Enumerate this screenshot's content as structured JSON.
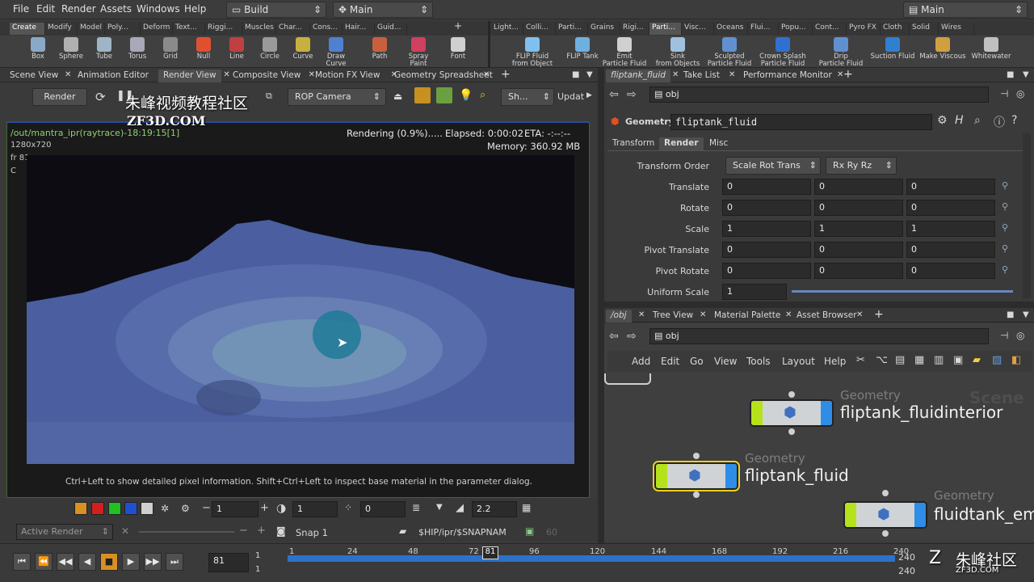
{
  "menubar": {
    "items": [
      "File",
      "Edit",
      "Render",
      "Assets",
      "Windows",
      "Help"
    ],
    "desktop": "Build",
    "context": "Main",
    "right": "Main"
  },
  "shelf_tabs_left": [
    "Create",
    "Modify",
    "Model",
    "Poly...",
    "Deform",
    "Text...",
    "Riggi...",
    "Muscles",
    "Char...",
    "Cons...",
    "Hair...",
    "Guid..."
  ],
  "shelf_tabs_right": [
    "Light...",
    "Colli...",
    "Parti...",
    "Grains",
    "Rigi...",
    "Parti...",
    "Visc...",
    "Oceans",
    "Flui...",
    "Popu...",
    "Cont...",
    "Pyro FX",
    "Cloth",
    "Solid",
    "Wires"
  ],
  "tools_left": [
    {
      "label": "Box",
      "color": "#8aa8c8"
    },
    {
      "label": "Sphere",
      "color": "#b0b0b0"
    },
    {
      "label": "Tube",
      "color": "#a0b4c8"
    },
    {
      "label": "Torus",
      "color": "#a8a8b8"
    },
    {
      "label": "Grid",
      "color": "#8a8a8a"
    },
    {
      "label": "Null",
      "color": "#e05030"
    },
    {
      "label": "Line",
      "color": "#c04040"
    },
    {
      "label": "Circle",
      "color": "#9a9a9a"
    },
    {
      "label": "Curve",
      "color": "#c8b040"
    },
    {
      "label": "Draw Curve",
      "color": "#5080d0"
    },
    {
      "label": "Path",
      "color": "#c86040"
    },
    {
      "label": "Spray Paint",
      "color": "#d04060"
    },
    {
      "label": "Font",
      "color": "#d0d0d0"
    }
  ],
  "tools_right": [
    {
      "label": "FLIP Fluid\nfrom Object",
      "color": "#80c0f0"
    },
    {
      "label": "FLIP Tank",
      "color": "#70b0e0"
    },
    {
      "label": "Emit\nParticle Fluid",
      "color": "#d0d0d0"
    },
    {
      "label": "Sink\nfrom Objects",
      "color": "#a0c0e0"
    },
    {
      "label": "Sculpted\nParticle Fluid",
      "color": "#6090d0"
    },
    {
      "label": "Crown Splash\nParticle Fluid",
      "color": "#3070d0"
    },
    {
      "label": "Drip\nParticle Fluid",
      "color": "#6090d0"
    },
    {
      "label": "Suction Fluid",
      "color": "#3080d0"
    },
    {
      "label": "Make Viscous",
      "color": "#d0a040"
    },
    {
      "label": "Whitewater",
      "color": "#c0c0c0"
    }
  ],
  "viewer_tabs": [
    "Scene View",
    "Animation Editor",
    "Render View",
    "Composite View",
    "Motion FX View",
    "Geometry Spreadsheet"
  ],
  "render_toolbar": {
    "render": "Render",
    "camera": "ROP Camera",
    "sh": "Sh...",
    "update": "Updat"
  },
  "render_info": {
    "path": "/out/mantra_ipr(raytrace)-18:19:15[1]",
    "res": "1280x720",
    "frame": "fr 81",
    "channel": "C",
    "status": "Rendering (0.9%).....",
    "elapsed": "Elapsed: 0:00:02",
    "eta": "ETA: -:--:--",
    "memory": "Memory:   360.92 MB",
    "hint": "Ctrl+Left to show detailed pixel information. Shift+Ctrl+Left to inspect base material in the parameter dialog."
  },
  "render_controls": {
    "frame_field": "1",
    "exposure": "1",
    "offset": "0",
    "gamma": "2.2",
    "active_render": "Active Render",
    "snap": "Snap 1",
    "snap_path": "$HIP/ipr/$SNAPNAM",
    "snap_num": "60"
  },
  "params_tabs": [
    "fliptank_fluid",
    "Take List",
    "Performance Monitor"
  ],
  "params": {
    "path": "obj",
    "type": "Geometry",
    "name": "fliptank_fluid",
    "subtabs": [
      "Transform",
      "Render",
      "Misc"
    ],
    "transform_order": "Scale Rot Trans",
    "rot_order": "Rx Ry Rz",
    "rows": [
      {
        "label": "Translate",
        "v": [
          "0",
          "0",
          "0"
        ]
      },
      {
        "label": "Rotate",
        "v": [
          "0",
          "0",
          "0"
        ]
      },
      {
        "label": "Scale",
        "v": [
          "1",
          "1",
          "1"
        ]
      },
      {
        "label": "Pivot Translate",
        "v": [
          "0",
          "0",
          "0"
        ]
      },
      {
        "label": "Pivot Rotate",
        "v": [
          "0",
          "0",
          "0"
        ]
      }
    ],
    "transform_order_label": "Transform Order",
    "uniform_label": "Uniform Scale",
    "uniform": "1"
  },
  "network_tabs": [
    "/obj",
    "Tree View",
    "Material Palette",
    "Asset Browser"
  ],
  "network": {
    "path": "obj",
    "menu": [
      "Add",
      "Edit",
      "Go",
      "View",
      "Tools",
      "Layout",
      "Help"
    ],
    "scene": "Scene",
    "nodes": [
      {
        "type": "Geometry",
        "name": "fliptank_fluidinterior"
      },
      {
        "type": "Geometry",
        "name": "fliptank_fluid"
      },
      {
        "type": "Geometry",
        "name": "fluidtank_em"
      }
    ]
  },
  "timeline": {
    "current": "81",
    "start": "1",
    "end": "1",
    "ticks": [
      "1",
      "24",
      "48",
      "72",
      "81",
      "96",
      "120",
      "144",
      "168",
      "192",
      "216",
      "240"
    ],
    "right_a": "240",
    "right_b": "240"
  },
  "watermark": {
    "top": "朱峰视频教程社区",
    "url": "ZF3D.COM",
    "corner": "朱峰社区",
    "corner_url": "ZF3D.COM"
  }
}
